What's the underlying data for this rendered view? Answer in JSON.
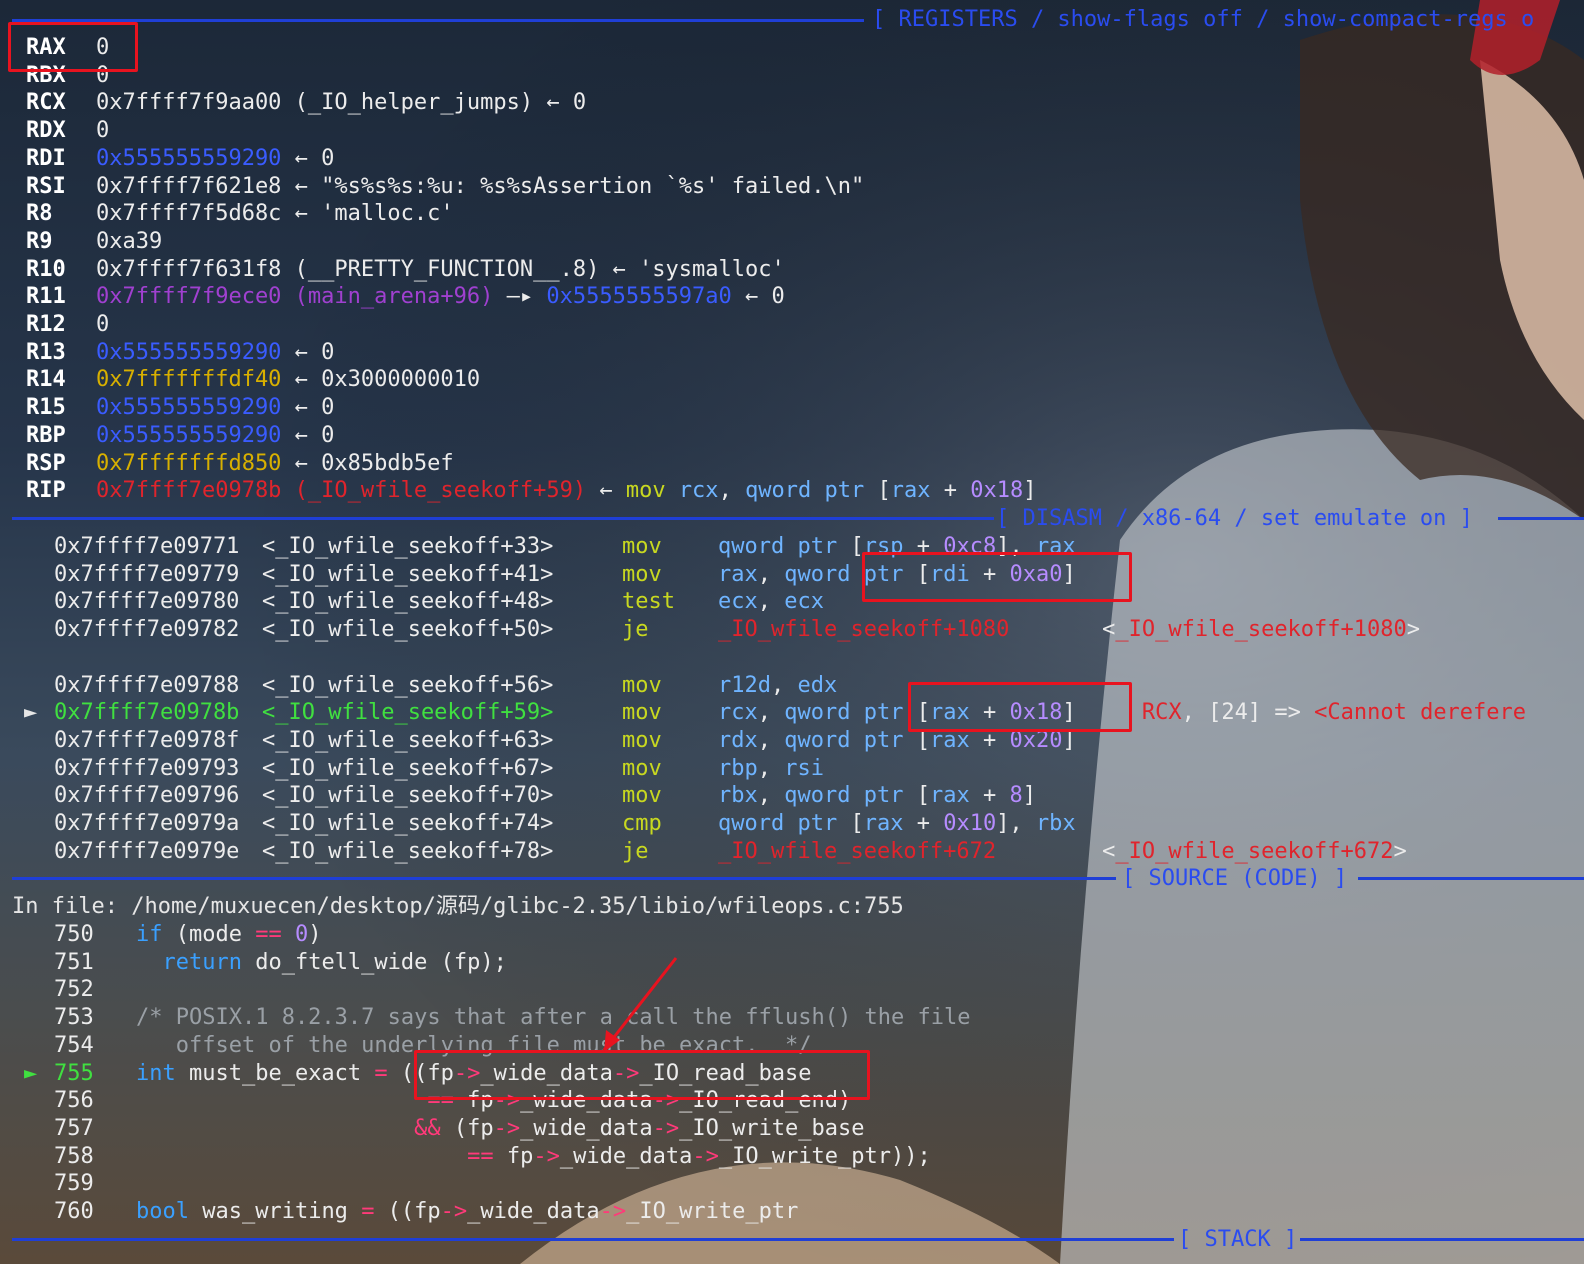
{
  "registers_header": "[ REGISTERS / show-flags off / show-compact-regs o",
  "registers": [
    {
      "name": "RAX",
      "parts": [
        {
          "t": "0",
          "c": "c-white"
        }
      ]
    },
    {
      "name": "RBX",
      "parts": [
        {
          "t": "0",
          "c": "c-white"
        }
      ]
    },
    {
      "name": "RCX",
      "parts": [
        {
          "t": "0x7ffff7f9aa00 (_IO_helper_jumps) ← 0",
          "c": "c-white"
        }
      ]
    },
    {
      "name": "RDX",
      "parts": [
        {
          "t": "0",
          "c": "c-white"
        }
      ]
    },
    {
      "name": "RDI",
      "parts": [
        {
          "t": "0x555555559290",
          "c": "c-blue"
        },
        {
          "t": " ← 0",
          "c": "c-white"
        }
      ]
    },
    {
      "name": "RSI",
      "parts": [
        {
          "t": "0x7ffff7f621e8 ← \"%s%s%s:%u: %s%sAssertion `%s' failed.\\n\"",
          "c": "c-white"
        }
      ]
    },
    {
      "name": "R8",
      "parts": [
        {
          "t": "0x7ffff7f5d68c ← 'malloc.c'",
          "c": "c-white"
        }
      ]
    },
    {
      "name": "R9",
      "parts": [
        {
          "t": "0xa39",
          "c": "c-white"
        }
      ]
    },
    {
      "name": "R10",
      "parts": [
        {
          "t": "0x7ffff7f631f8 (__PRETTY_FUNCTION__.8) ← 'sysmalloc'",
          "c": "c-white"
        }
      ]
    },
    {
      "name": "R11",
      "parts": [
        {
          "t": "0x7ffff7f9ece0 (main_arena+96)",
          "c": "c-purple"
        },
        {
          "t": " —▸ ",
          "c": "c-white"
        },
        {
          "t": "0x5555555597a0",
          "c": "c-blue"
        },
        {
          "t": " ← 0",
          "c": "c-white"
        }
      ]
    },
    {
      "name": "R12",
      "parts": [
        {
          "t": "0",
          "c": "c-white"
        }
      ]
    },
    {
      "name": "R13",
      "parts": [
        {
          "t": "0x555555559290",
          "c": "c-blue"
        },
        {
          "t": " ← 0",
          "c": "c-white"
        }
      ]
    },
    {
      "name": "R14",
      "parts": [
        {
          "t": "0x7fffffffdf40",
          "c": "c-yellow"
        },
        {
          "t": " ← 0x3000000010",
          "c": "c-white"
        }
      ]
    },
    {
      "name": "R15",
      "parts": [
        {
          "t": "0x555555559290",
          "c": "c-blue"
        },
        {
          "t": " ← 0",
          "c": "c-white"
        }
      ]
    },
    {
      "name": "RBP",
      "parts": [
        {
          "t": "0x555555559290",
          "c": "c-blue"
        },
        {
          "t": " ← 0",
          "c": "c-white"
        }
      ]
    },
    {
      "name": "RSP",
      "parts": [
        {
          "t": "0x7fffffffd850",
          "c": "c-yellow"
        },
        {
          "t": " ← 0x85bdb5ef",
          "c": "c-white"
        }
      ]
    },
    {
      "name": "RIP",
      "parts": [
        {
          "t": "0x7ffff7e0978b (_IO_wfile_seekoff+59)",
          "c": "c-red"
        },
        {
          "t": " ← ",
          "c": "c-white"
        },
        {
          "t": "mov ",
          "c": "c-mn"
        },
        {
          "t": "rcx",
          "c": "c-reg"
        },
        {
          "t": ", ",
          "c": "c-white"
        },
        {
          "t": "qword ptr ",
          "c": "c-reg"
        },
        {
          "t": "[",
          "c": "c-white"
        },
        {
          "t": "rax",
          "c": "c-reg"
        },
        {
          "t": " + ",
          "c": "c-white"
        },
        {
          "t": "0x18",
          "c": "c-num"
        },
        {
          "t": "]",
          "c": "c-white"
        }
      ]
    }
  ],
  "disasm_header": "[ DISASM / x86-64 / set emulate on ]",
  "disasm": [
    {
      "addr": "0x7ffff7e09771",
      "sym": "<_IO_wfile_seekoff+33>",
      "mn": "mov",
      "ops": [
        {
          "t": "qword ptr ",
          "c": "c-reg"
        },
        {
          "t": "[",
          "c": "c-white"
        },
        {
          "t": "rsp",
          "c": "c-reg"
        },
        {
          "t": " + ",
          "c": "c-white"
        },
        {
          "t": "0xc8",
          "c": "c-num"
        },
        {
          "t": "], ",
          "c": "c-white"
        },
        {
          "t": "rax",
          "c": "c-reg"
        }
      ],
      "cur": false
    },
    {
      "addr": "0x7ffff7e09779",
      "sym": "<_IO_wfile_seekoff+41>",
      "mn": "mov",
      "ops": [
        {
          "t": "rax",
          "c": "c-reg"
        },
        {
          "t": ", ",
          "c": "c-white"
        },
        {
          "t": "qword ptr ",
          "c": "c-reg"
        },
        {
          "t": "[",
          "c": "c-white"
        },
        {
          "t": "rdi",
          "c": "c-reg"
        },
        {
          "t": " + ",
          "c": "c-white"
        },
        {
          "t": "0xa0",
          "c": "c-num"
        },
        {
          "t": "]",
          "c": "c-white"
        }
      ],
      "cur": false
    },
    {
      "addr": "0x7ffff7e09780",
      "sym": "<_IO_wfile_seekoff+48>",
      "mn": "test",
      "ops": [
        {
          "t": "ecx",
          "c": "c-reg"
        },
        {
          "t": ", ",
          "c": "c-white"
        },
        {
          "t": "ecx",
          "c": "c-reg"
        }
      ],
      "cur": false
    },
    {
      "addr": "0x7ffff7e09782",
      "sym": "<_IO_wfile_seekoff+50>",
      "mn": "je",
      "ops": [
        {
          "t": "_IO_wfile_seekoff+1080",
          "c": "c-red"
        },
        {
          "t": "       <",
          "c": "c-white"
        },
        {
          "t": "_IO_wfile_seekoff+1080",
          "c": "c-red"
        },
        {
          "t": ">",
          "c": "c-white"
        }
      ],
      "cur": false
    },
    {
      "addr": "",
      "sym": "",
      "mn": "",
      "ops": [],
      "cur": false
    },
    {
      "addr": "0x7ffff7e09788",
      "sym": "<_IO_wfile_seekoff+56>",
      "mn": "mov",
      "ops": [
        {
          "t": "r12d",
          "c": "c-reg"
        },
        {
          "t": ", ",
          "c": "c-white"
        },
        {
          "t": "edx",
          "c": "c-reg"
        }
      ],
      "cur": false
    },
    {
      "addr": "0x7ffff7e0978b",
      "sym": "<_IO_wfile_seekoff+59>",
      "mn": "mov",
      "ops": [
        {
          "t": "rcx",
          "c": "c-reg"
        },
        {
          "t": ", ",
          "c": "c-white"
        },
        {
          "t": "qword ptr ",
          "c": "c-reg"
        },
        {
          "t": "[",
          "c": "c-white"
        },
        {
          "t": "rax",
          "c": "c-reg"
        },
        {
          "t": " + ",
          "c": "c-white"
        },
        {
          "t": "0x18",
          "c": "c-num"
        },
        {
          "t": "]",
          "c": "c-white"
        },
        {
          "t": "     RCX",
          "c": "c-red"
        },
        {
          "t": ", [24] => ",
          "c": "c-white"
        },
        {
          "t": "<Cannot derefere",
          "c": "c-red"
        }
      ],
      "cur": true
    },
    {
      "addr": "0x7ffff7e0978f",
      "sym": "<_IO_wfile_seekoff+63>",
      "mn": "mov",
      "ops": [
        {
          "t": "rdx",
          "c": "c-reg"
        },
        {
          "t": ", ",
          "c": "c-white"
        },
        {
          "t": "qword ptr ",
          "c": "c-reg"
        },
        {
          "t": "[",
          "c": "c-white"
        },
        {
          "t": "rax",
          "c": "c-reg"
        },
        {
          "t": " + ",
          "c": "c-white"
        },
        {
          "t": "0x20",
          "c": "c-num"
        },
        {
          "t": "]",
          "c": "c-white"
        }
      ],
      "cur": false
    },
    {
      "addr": "0x7ffff7e09793",
      "sym": "<_IO_wfile_seekoff+67>",
      "mn": "mov",
      "ops": [
        {
          "t": "rbp",
          "c": "c-reg"
        },
        {
          "t": ", ",
          "c": "c-white"
        },
        {
          "t": "rsi",
          "c": "c-reg"
        }
      ],
      "cur": false
    },
    {
      "addr": "0x7ffff7e09796",
      "sym": "<_IO_wfile_seekoff+70>",
      "mn": "mov",
      "ops": [
        {
          "t": "rbx",
          "c": "c-reg"
        },
        {
          "t": ", ",
          "c": "c-white"
        },
        {
          "t": "qword ptr ",
          "c": "c-reg"
        },
        {
          "t": "[",
          "c": "c-white"
        },
        {
          "t": "rax",
          "c": "c-reg"
        },
        {
          "t": " + ",
          "c": "c-white"
        },
        {
          "t": "8",
          "c": "c-num"
        },
        {
          "t": "]",
          "c": "c-white"
        }
      ],
      "cur": false
    },
    {
      "addr": "0x7ffff7e0979a",
      "sym": "<_IO_wfile_seekoff+74>",
      "mn": "cmp",
      "ops": [
        {
          "t": "qword ptr ",
          "c": "c-reg"
        },
        {
          "t": "[",
          "c": "c-white"
        },
        {
          "t": "rax",
          "c": "c-reg"
        },
        {
          "t": " + ",
          "c": "c-white"
        },
        {
          "t": "0x10",
          "c": "c-num"
        },
        {
          "t": "], ",
          "c": "c-white"
        },
        {
          "t": "rbx",
          "c": "c-reg"
        }
      ],
      "cur": false
    },
    {
      "addr": "0x7ffff7e0979e",
      "sym": "<_IO_wfile_seekoff+78>",
      "mn": "je",
      "ops": [
        {
          "t": "_IO_wfile_seekoff+672",
          "c": "c-red"
        },
        {
          "t": "        <",
          "c": "c-white"
        },
        {
          "t": "_IO_wfile_seekoff+672",
          "c": "c-red"
        },
        {
          "t": ">",
          "c": "c-white"
        }
      ],
      "cur": false
    }
  ],
  "source_header": "[ SOURCE (CODE) ]",
  "source_file": "In file: /home/muxuecen/desktop/源码/glibc-2.35/libio/wfileops.c:755",
  "source": [
    {
      "n": "750",
      "cur": false,
      "parts": [
        {
          "t": "if ",
          "c": "c-kw"
        },
        {
          "t": "(mode ",
          "c": "c-white"
        },
        {
          "t": "==",
          "c": "c-pink"
        },
        {
          "t": " ",
          "c": "c-white"
        },
        {
          "t": "0",
          "c": "c-num"
        },
        {
          "t": ")",
          "c": "c-white"
        }
      ]
    },
    {
      "n": "751",
      "cur": false,
      "parts": [
        {
          "t": "  return ",
          "c": "c-kw"
        },
        {
          "t": "do_ftell_wide (fp);",
          "c": "c-white"
        }
      ]
    },
    {
      "n": "752",
      "cur": false,
      "parts": []
    },
    {
      "n": "753",
      "cur": false,
      "parts": [
        {
          "t": "/* POSIX.1 8.2.3.7 says that after a call the fflush() the file",
          "c": "c-cmt"
        }
      ]
    },
    {
      "n": "754",
      "cur": false,
      "parts": [
        {
          "t": "   offset of the underlying file must be exact.  */",
          "c": "c-cmt"
        }
      ]
    },
    {
      "n": "755",
      "cur": true,
      "parts": [
        {
          "t": "int ",
          "c": "c-kw"
        },
        {
          "t": "must_be_exact ",
          "c": "c-white"
        },
        {
          "t": "=",
          "c": "c-pink"
        },
        {
          "t": " ((fp",
          "c": "c-white"
        },
        {
          "t": "->",
          "c": "c-pink"
        },
        {
          "t": "_wide_data",
          "c": "c-white"
        },
        {
          "t": "->",
          "c": "c-pink"
        },
        {
          "t": "_IO_read_base",
          "c": "c-white"
        }
      ]
    },
    {
      "n": "756",
      "cur": false,
      "parts": [
        {
          "t": "                      ",
          "c": "c-white"
        },
        {
          "t": "==",
          "c": "c-pink"
        },
        {
          "t": " fp",
          "c": "c-white"
        },
        {
          "t": "->",
          "c": "c-pink"
        },
        {
          "t": "_wide_data",
          "c": "c-white"
        },
        {
          "t": "->",
          "c": "c-pink"
        },
        {
          "t": "_IO_read_end)",
          "c": "c-white"
        }
      ]
    },
    {
      "n": "757",
      "cur": false,
      "parts": [
        {
          "t": "                     ",
          "c": "c-white"
        },
        {
          "t": "&&",
          "c": "c-pink"
        },
        {
          "t": " (fp",
          "c": "c-white"
        },
        {
          "t": "->",
          "c": "c-pink"
        },
        {
          "t": "_wide_data",
          "c": "c-white"
        },
        {
          "t": "->",
          "c": "c-pink"
        },
        {
          "t": "_IO_write_base",
          "c": "c-white"
        }
      ]
    },
    {
      "n": "758",
      "cur": false,
      "parts": [
        {
          "t": "                         ",
          "c": "c-white"
        },
        {
          "t": "==",
          "c": "c-pink"
        },
        {
          "t": " fp",
          "c": "c-white"
        },
        {
          "t": "->",
          "c": "c-pink"
        },
        {
          "t": "_wide_data",
          "c": "c-white"
        },
        {
          "t": "->",
          "c": "c-pink"
        },
        {
          "t": "_IO_write_ptr));",
          "c": "c-white"
        }
      ]
    },
    {
      "n": "759",
      "cur": false,
      "parts": []
    },
    {
      "n": "760",
      "cur": false,
      "parts": [
        {
          "t": "bool ",
          "c": "c-kw"
        },
        {
          "t": "was_writing ",
          "c": "c-white"
        },
        {
          "t": "=",
          "c": "c-pink"
        },
        {
          "t": " ((fp",
          "c": "c-white"
        },
        {
          "t": "->",
          "c": "c-pink"
        },
        {
          "t": "_wide_data",
          "c": "c-white"
        },
        {
          "t": "->",
          "c": "c-pink"
        },
        {
          "t": "_IO_write_ptr",
          "c": "c-white"
        }
      ]
    }
  ],
  "stack_header": "[ STACK ]",
  "cursor_marker": "►",
  "colors": {
    "separator": "#1f3fd6",
    "highlight_box": "#e8131f",
    "current_line": "#40e040"
  }
}
